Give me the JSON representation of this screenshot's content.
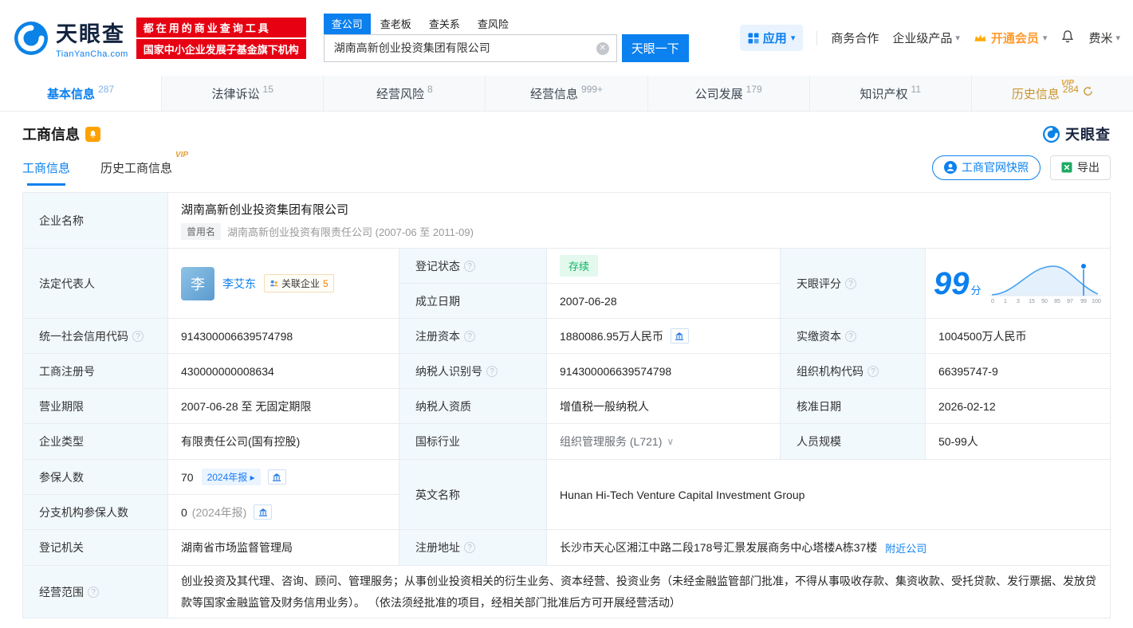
{
  "colors": {
    "brand_blue": "#0b80ef",
    "promo_red": "#e60012",
    "vip_gold": "#c9952c",
    "status_green": "#0bb463"
  },
  "icons": {
    "clear": "✕",
    "caret": "▾",
    "expand": "∨",
    "arrow": "▸",
    "question": "?"
  },
  "brand": {
    "name": "天眼查",
    "domain": "TianYanCha.com"
  },
  "header": {
    "promo_line1": "都在用的商业查询工具",
    "promo_line2": "国家中小企业发展子基金旗下机构",
    "search_tabs": [
      {
        "label": "查公司"
      },
      {
        "label": "查老板"
      },
      {
        "label": "查关系"
      },
      {
        "label": "查风险"
      }
    ],
    "search_value": "湖南高新创业投资集团有限公司",
    "search_button": "天眼一下",
    "apps_label": "应用",
    "link_cooperation": "商务合作",
    "link_enterprise": "企业级产品",
    "vip_label": "开通会员",
    "user_name": "费米"
  },
  "nav": {
    "tabs": [
      {
        "label": "基本信息",
        "count": "287"
      },
      {
        "label": "法律诉讼",
        "count": "15"
      },
      {
        "label": "经营风险",
        "count": "8"
      },
      {
        "label": "经营信息",
        "count": "999+"
      },
      {
        "label": "公司发展",
        "count": "179"
      },
      {
        "label": "知识产权",
        "count": "11"
      },
      {
        "label": "历史信息",
        "count": "284",
        "vip": "VIP"
      }
    ]
  },
  "section": {
    "title": "工商信息",
    "brand": "天眼查",
    "tab_current": "工商信息",
    "tab_history": "历史工商信息",
    "tab_history_vip": "VIP",
    "btn_snapshot": "工商官网快照",
    "btn_export": "导出"
  },
  "info": {
    "company_name_label": "企业名称",
    "company_name": "湖南高新创业投资集团有限公司",
    "former_badge": "曾用名",
    "former_name": "湖南高新创业投资有限责任公司 (2007-06 至 2011-09)",
    "legal_rep_label": "法定代表人",
    "legal_rep_avatar": "李",
    "legal_rep_name": "李艾东",
    "related_label": "关联企业",
    "related_count": "5",
    "status_label": "登记状态",
    "status_value": "存续",
    "established_label": "成立日期",
    "established_value": "2007-06-28",
    "score_label": "天眼评分",
    "score_value": "99",
    "score_unit": "分",
    "credit_code_label": "统一社会信用代码",
    "credit_code": "914300006639574798",
    "reg_capital_label": "注册资本",
    "reg_capital": "1880086.95万人民币",
    "paid_capital_label": "实缴资本",
    "paid_capital": "1004500万人民币",
    "reg_number_label": "工商注册号",
    "reg_number": "430000000008634",
    "taxpayer_id_label": "纳税人识别号",
    "taxpayer_id": "914300006639574798",
    "org_code_label": "组织机构代码",
    "org_code": "66395747-9",
    "term_label": "营业期限",
    "term_value": "2007-06-28 至 无固定期限",
    "taxpayer_quality_label": "纳税人资质",
    "taxpayer_quality": "增值税一般纳税人",
    "approval_date_label": "核准日期",
    "approval_date": "2026-02-12",
    "company_type_label": "企业类型",
    "company_type": "有限责任公司(国有控股)",
    "industry_label": "国标行业",
    "industry_value": "组织管理服务 (L721)",
    "staff_size_label": "人员规模",
    "staff_size": "50-99人",
    "insured_label": "参保人数",
    "insured_value": "70",
    "insured_badge": "2024年报",
    "english_name_label": "英文名称",
    "english_name": "Hunan Hi-Tech Venture Capital Investment Group",
    "branch_insured_label": "分支机构参保人数",
    "branch_insured_value": "0",
    "branch_insured_note": "(2024年报)",
    "authority_label": "登记机关",
    "authority_value": "湖南省市场监督管理局",
    "address_label": "注册地址",
    "address_value": "长沙市天心区湘江中路二段178号汇景发展商务中心塔楼A栋37楼",
    "nearby_link": "附近公司",
    "scope_label": "经营范围",
    "scope_value": "创业投资及其代理、咨询、顾问、管理服务；从事创业投资相关的衍生业务、资本经营、投资业务（未经金融监管部门批准，不得从事吸收存款、集资收款、受托贷款、发行票据、发放贷款等国家金融监管及财务信用业务）。 （依法须经批准的项目，经相关部门批准后方可开展经营活动）"
  },
  "score_chart": {
    "type": "line",
    "title": "天眼评分分布曲线",
    "x_ticks": [
      "0",
      "1",
      "3",
      "15",
      "50",
      "85",
      "97",
      "99",
      "100"
    ],
    "score": 99,
    "marker_at": "99",
    "curve": "bell-shaped distribution, marker dot at score 99 near right edge"
  }
}
